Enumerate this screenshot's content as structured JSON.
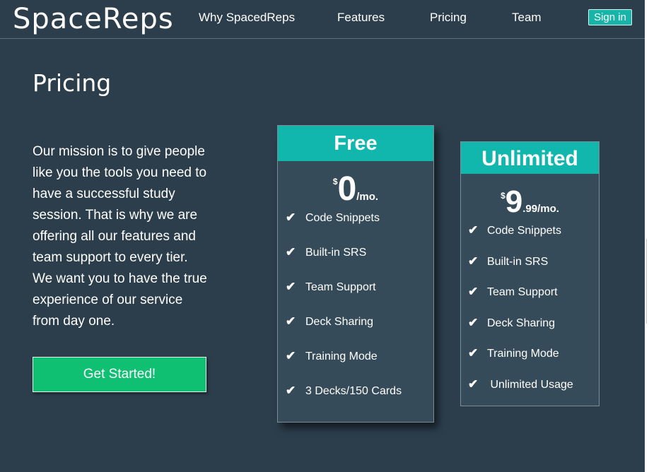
{
  "nav": {
    "logo": "SpaceReps",
    "links": [
      "Why SpacedReps",
      "Features",
      "Pricing",
      "Team"
    ],
    "signin": "Sign in"
  },
  "page": {
    "title": "Pricing",
    "mission": "Our mission is to give people like you the tools you need to have a successful study session. That is why we are offering all our features and team support to every tier. We want you to have the true experience of our service from day one.",
    "cta": "Get Started!"
  },
  "plans": [
    {
      "name": "Free",
      "currency": "$",
      "amount": "0",
      "period": "/mo.",
      "features": [
        "Code Snippets",
        "Built-in SRS",
        "Team Support",
        "Deck Sharing",
        "Training Mode",
        "3 Decks/150 Cards"
      ]
    },
    {
      "name": "Unlimited",
      "currency": "$",
      "amount": "9",
      "period": ".99/mo.",
      "features": [
        "Code Snippets",
        "Built-in SRS",
        "Team Support",
        "Deck Sharing",
        "Training Mode",
        " Unlimited Usage"
      ]
    }
  ],
  "icons": {
    "feature_check": "check-icon"
  },
  "colors": {
    "background": "#2c3e4c",
    "accent": "#11b7ad",
    "cta": "#0fbf72",
    "card": "#364b59"
  }
}
